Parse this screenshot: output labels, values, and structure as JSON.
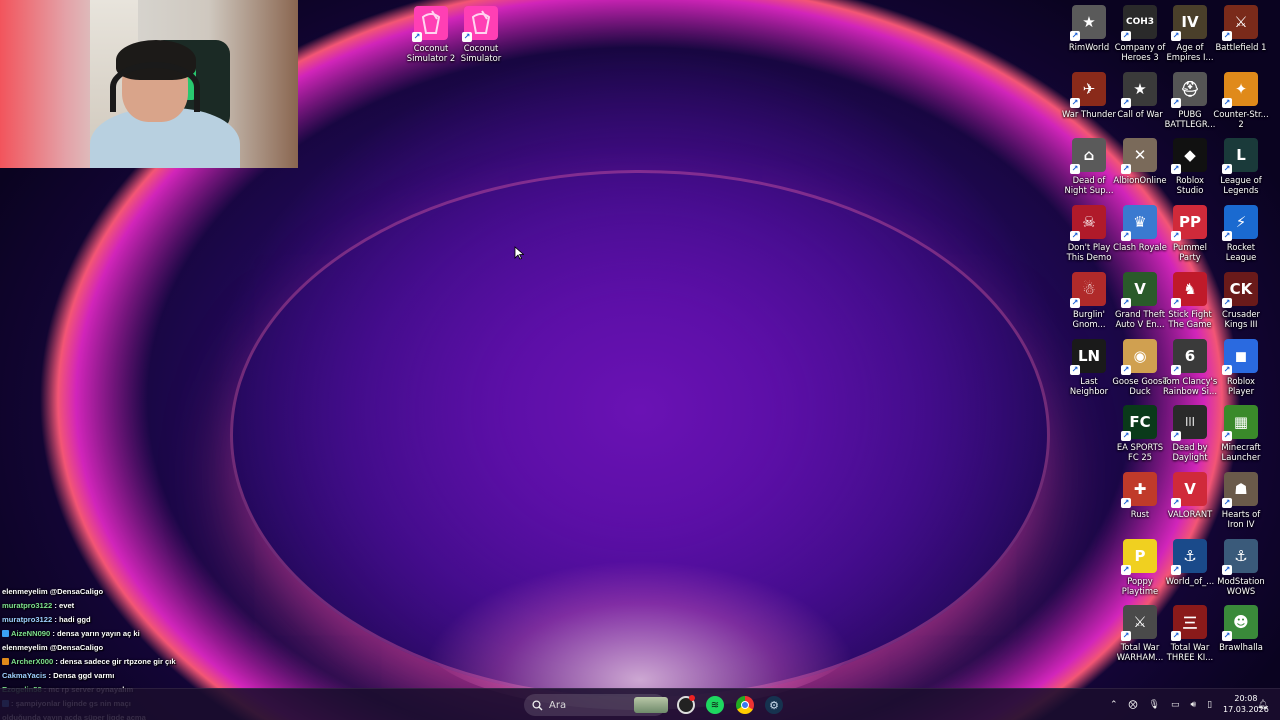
{
  "webcam": {
    "present": true
  },
  "desktop": {
    "top_icons": [
      {
        "label": "Coconut Simulator 2",
        "icon": "coconut-drink-icon",
        "color": "#ff3fb4"
      },
      {
        "label": "Coconut Simulator",
        "icon": "coconut-drink-icon",
        "color": "#ff3fb4"
      }
    ],
    "right_icons": [
      {
        "label": "RimWorld",
        "icon": "rimworld-icon",
        "color": "#5a5a5a",
        "glyph": "★"
      },
      {
        "label": "Company of Heroes 3",
        "icon": "coh3-icon",
        "color": "#2a2a2a",
        "glyph": "COH3"
      },
      {
        "label": "Age of Empires I...",
        "icon": "aoe4-icon",
        "color": "#4a3f2a",
        "glyph": "IV"
      },
      {
        "label": "Battlefield 1",
        "icon": "battlefield-icon",
        "color": "#7a2a1a",
        "glyph": "⚔"
      },
      {
        "label": "War Thunder",
        "icon": "war-thunder-icon",
        "color": "#8a2a1a",
        "glyph": "✈"
      },
      {
        "label": "Call of War",
        "icon": "call-of-war-icon",
        "color": "#3a3a3a",
        "glyph": "★"
      },
      {
        "label": "PUBG BATTLEGR...",
        "icon": "pubg-icon",
        "color": "#555",
        "glyph": "⛑"
      },
      {
        "label": "Counter-Str... 2",
        "icon": "cs2-icon",
        "color": "#e08a1a",
        "glyph": "✦"
      },
      {
        "label": "Dead of Night Sup...",
        "icon": "dead-of-night-icon",
        "color": "#5a5a5a",
        "glyph": "⌂"
      },
      {
        "label": "AlbionOnline",
        "icon": "albion-icon",
        "color": "#7a6a5a",
        "glyph": "✕"
      },
      {
        "label": "Roblox Studio",
        "icon": "roblox-studio-icon",
        "color": "#111",
        "glyph": "◆"
      },
      {
        "label": "League of Legends",
        "icon": "lol-icon",
        "color": "#1a3a3a",
        "glyph": "L"
      },
      {
        "label": "Don't Play This Demo",
        "icon": "skull-icon",
        "color": "#b01a2a",
        "glyph": "☠"
      },
      {
        "label": "Clash Royale",
        "icon": "clash-royale-icon",
        "color": "#3a7ad0",
        "glyph": "♛"
      },
      {
        "label": "Pummel Party",
        "icon": "pummel-party-icon",
        "color": "#d02a3a",
        "glyph": "PP"
      },
      {
        "label": "Rocket League",
        "icon": "rocket-league-icon",
        "color": "#1a6ad0",
        "glyph": "⚡"
      },
      {
        "label": "Burglin' Gnom...",
        "icon": "gnome-icon",
        "color": "#b02a2a",
        "glyph": "☃"
      },
      {
        "label": "Grand Theft Auto V En...",
        "icon": "gta5-icon",
        "color": "#2a5a2a",
        "glyph": "V"
      },
      {
        "label": "Stick Fight The Game",
        "icon": "stick-fight-icon",
        "color": "#c01a2a",
        "glyph": "♞"
      },
      {
        "label": "Crusader Kings III",
        "icon": "ck3-icon",
        "color": "#6a1a1a",
        "glyph": "CK"
      },
      {
        "label": "Last Neighbor",
        "icon": "last-neighbor-icon",
        "color": "#1a1a1a",
        "glyph": "LN"
      },
      {
        "label": "Goose Goose Duck",
        "icon": "goose-icon",
        "color": "#d0a050",
        "glyph": "◉"
      },
      {
        "label": "Tom Clancy's Rainbow Si...",
        "icon": "r6-icon",
        "color": "#3a3a3a",
        "glyph": "6"
      },
      {
        "label": "Roblox Player",
        "icon": "roblox-icon",
        "color": "#2a6ae0",
        "glyph": "◼"
      },
      {
        "label": "EA SPORTS FC 25",
        "icon": "fc25-icon",
        "color": "#0a3a1a",
        "glyph": "FC"
      },
      {
        "label": "Dead by Daylight",
        "icon": "dbd-icon",
        "color": "#2a2a2a",
        "glyph": "|||"
      },
      {
        "label": "Minecraft Launcher",
        "icon": "minecraft-icon",
        "color": "#3a8a2a",
        "glyph": "▦"
      },
      {
        "label": "Rust",
        "icon": "rust-icon",
        "color": "#c03a2a",
        "glyph": "✚"
      },
      {
        "label": "VALORANT",
        "icon": "valorant-icon",
        "color": "#d02a3a",
        "glyph": "V"
      },
      {
        "label": "Hearts of Iron IV",
        "icon": "hoi4-icon",
        "color": "#6a5a4a",
        "glyph": "☗"
      },
      {
        "label": "Poppy Playtime",
        "icon": "poppy-icon",
        "color": "#f0d020",
        "glyph": "P"
      },
      {
        "label": "World_of_...",
        "icon": "world-of-warships-icon",
        "color": "#1a4a8a",
        "glyph": "⚓"
      },
      {
        "label": "ModStation WOWS",
        "icon": "modstation-icon",
        "color": "#3a5a7a",
        "glyph": "⚓"
      },
      {
        "label": "Total War WARHAM...",
        "icon": "total-war-warhammer-icon",
        "color": "#4a4a4a",
        "glyph": "⚔"
      },
      {
        "label": "Total War THREE KI...",
        "icon": "total-war-three-kingdoms-icon",
        "color": "#8a1a1a",
        "glyph": "三"
      },
      {
        "label": "Brawlhalla",
        "icon": "brawlhalla-icon",
        "color": "#3a8a3a",
        "glyph": "☻"
      }
    ]
  },
  "chat": [
    {
      "user": "",
      "text": "elenmeyelim @DensaCaligo"
    },
    {
      "user": "muratpro3122",
      "text": ": evet"
    },
    {
      "user": "muratpro3122",
      "text": ": hadi ggd"
    },
    {
      "user": "AizeNN090",
      "text": ": densa yarın yayın aç ki",
      "mark": "#3aa0f3"
    },
    {
      "user": "",
      "text": "elenmeyelim @DensaCaligo"
    },
    {
      "user": "ArcherX000",
      "text": ": densa sadece gir rtpzone gir çık",
      "mark": "#e08a1a"
    },
    {
      "user": "CakmaYacis",
      "text": ": Densa ggd varmı"
    },
    {
      "user": "Ezogelin58",
      "text": ": mc rp server oynayalım"
    },
    {
      "user": "",
      "text": ": şampiyonlar liginde gs nin maçı",
      "mark": "#3aa0f3"
    },
    {
      "user": "",
      "text": "olduğunda yayın açda süper ligde açma"
    }
  ],
  "taskbar": {
    "search_placeholder": "Ara",
    "time": "20:08",
    "date": "17.03.2026",
    "pinned": [
      "widget-icon",
      "app-icon",
      "spotify-icon",
      "chrome-icon",
      "steam-icon"
    ]
  }
}
